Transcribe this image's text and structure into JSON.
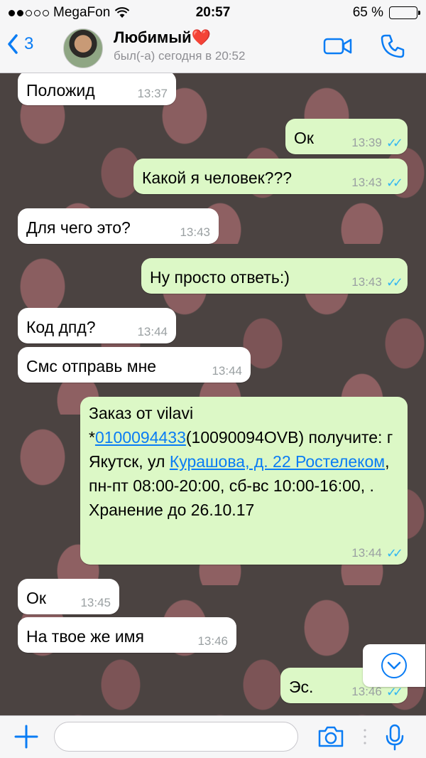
{
  "status_bar": {
    "carrier": "MegaFon",
    "time": "20:57",
    "battery": "65 %",
    "battery_level": 0.65
  },
  "header": {
    "back_count": "3",
    "contact_name": "Любимый",
    "contact_heart": "❤️",
    "last_seen": "был(-а) сегодня в 20:52"
  },
  "messages": [
    {
      "dir": "in",
      "text": "Положид",
      "time": "13:37"
    },
    {
      "dir": "out",
      "text": "Ок",
      "time": "13:39"
    },
    {
      "dir": "out",
      "text": "Какой я человек???",
      "time": "13:43"
    },
    {
      "dir": "in",
      "text": "Для чего это?",
      "time": "13:43"
    },
    {
      "dir": "out",
      "text": "Ну просто ответь:)",
      "time": "13:43"
    },
    {
      "dir": "in",
      "text": "Код дпд?",
      "time": "13:44"
    },
    {
      "dir": "in",
      "text": "Смс отправь мне",
      "time": "13:44"
    },
    {
      "dir": "out",
      "time": "13:44",
      "parts": {
        "p1": "Заказ от vilavi *",
        "link1": "0100094433",
        "p2": "(10090094OVB) получите: г Якутск, ул ",
        "link2": "Курашова, д. 22 Ростелеком",
        "p3": ", пн-пт 08:00-20:00, сб-вс 10:00-16:00, . Хранение до 26.10.17"
      }
    },
    {
      "dir": "in",
      "text": "Ок",
      "time": "13:45"
    },
    {
      "dir": "in",
      "text": "На твое же имя",
      "time": "13:46"
    },
    {
      "dir": "out",
      "text": "Эс.",
      "time": "13:46"
    }
  ],
  "colors": {
    "accent": "#0a7cf4",
    "bubble_out": "#dcf8c6",
    "bubble_in": "#ffffff",
    "read_ticks": "#34b7f1"
  },
  "icons": {
    "back": "chevron-left-icon",
    "video": "video-camera-icon",
    "call": "phone-icon",
    "attach": "plus-icon",
    "camera": "camera-icon",
    "mic": "microphone-icon",
    "scroll": "chevron-down-circle-icon"
  }
}
